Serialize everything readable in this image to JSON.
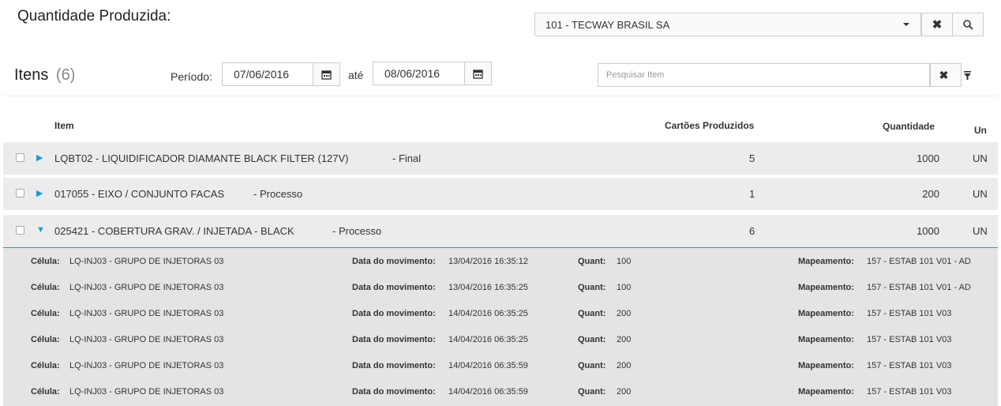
{
  "header": {
    "title": "Quantidade Produzida:",
    "company_value": "101 - TECWAY BRASIL SA"
  },
  "toolbar": {
    "items_title": "Itens",
    "items_count": "(6)",
    "periodo_label": "Período:",
    "date_from": "07/06/2016",
    "ate_label": "até",
    "date_to": "08/06/2016",
    "search_placeholder": "Pesquisar Item"
  },
  "table": {
    "headers": {
      "item": "Item",
      "cards": "Cartões Produzidos",
      "quantity": "Quantidade",
      "unit": "Un"
    },
    "rows": [
      {
        "code": "LQBT02 - LIQUIDIFICADOR DIAMANTE BLACK FILTER (127V)",
        "type": "- Final",
        "cards": "5",
        "quantity": "1000",
        "unit": "UN"
      },
      {
        "code": "017055 - EIXO / CONJUNTO FACAS",
        "type": "- Processo",
        "cards": "1",
        "quantity": "200",
        "unit": "UN"
      },
      {
        "code": "025421 - COBERTURA GRAV. / INJETADA - BLACK",
        "type": "- Processo",
        "cards": "6",
        "quantity": "1000",
        "unit": "UN"
      }
    ]
  },
  "details": {
    "labels": {
      "celula": "Célula:",
      "data": "Data do movimento:",
      "quant": "Quant:",
      "mapeamento": "Mapeamento:"
    },
    "rows": [
      {
        "celula": "LQ-INJ03 - GRUPO DE INJETORAS 03",
        "data": "13/04/2016 16:35:12",
        "quant": "100",
        "mapeamento": "157 - ESTAB 101 V01 - AD"
      },
      {
        "celula": "LQ-INJ03 - GRUPO DE INJETORAS 03",
        "data": "13/04/2016 16:35:25",
        "quant": "100",
        "mapeamento": "157 - ESTAB 101 V01 - AD"
      },
      {
        "celula": "LQ-INJ03 - GRUPO DE INJETORAS 03",
        "data": "14/04/2016 06:35:25",
        "quant": "200",
        "mapeamento": "157 - ESTAB 101 V03"
      },
      {
        "celula": "LQ-INJ03 - GRUPO DE INJETORAS 03",
        "data": "14/04/2016 06:35:25",
        "quant": "200",
        "mapeamento": "157 - ESTAB 101 V03"
      },
      {
        "celula": "LQ-INJ03 - GRUPO DE INJETORAS 03",
        "data": "14/04/2016 06:35:59",
        "quant": "200",
        "mapeamento": "157 - ESTAB 101 V03"
      },
      {
        "celula": "LQ-INJ03 - GRUPO DE INJETORAS 03",
        "data": "14/04/2016 06:35:59",
        "quant": "200",
        "mapeamento": "157 - ESTAB 101 V03"
      }
    ]
  },
  "colors": {
    "accent": "#1a9bd7",
    "row_bg": "#ececec",
    "detail_bg": "#e4e4e4"
  }
}
